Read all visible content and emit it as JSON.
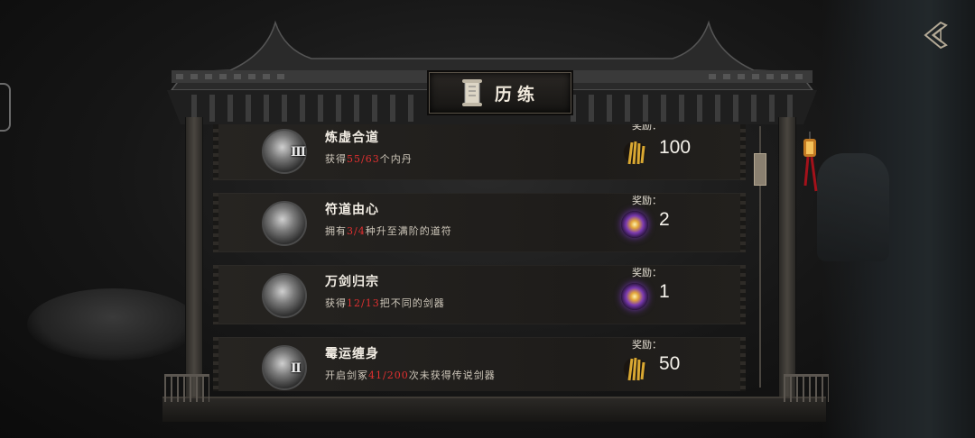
{
  "window": {
    "title": "历练"
  },
  "quests": [
    {
      "name": "炼虚合道",
      "desc_prefix": "获得",
      "progress": "55/63",
      "desc_suffix": "个内丹",
      "roman": "Ⅲ",
      "reward_label": "奖励：",
      "reward_icon": "gold-sword-bundle-icon",
      "reward_amount": "100"
    },
    {
      "name": "符道由心",
      "desc_prefix": "拥有",
      "progress": "3/4",
      "desc_suffix": "种升至满阶的道符",
      "roman": "",
      "reward_label": "奖励：",
      "reward_icon": "spirit-orb-icon",
      "reward_amount": "2"
    },
    {
      "name": "万剑归宗",
      "desc_prefix": "获得",
      "progress": "12/13",
      "desc_suffix": "把不同的剑器",
      "roman": "",
      "reward_label": "奖励：",
      "reward_icon": "spirit-orb-icon",
      "reward_amount": "1"
    },
    {
      "name": "霉运缠身",
      "desc_prefix": "开启剑冢",
      "progress": "41/200",
      "desc_suffix": "次未获得传说剑器",
      "roman": "Ⅱ",
      "reward_label": "奖励：",
      "reward_icon": "gold-sword-bundle-icon",
      "reward_amount": "50"
    }
  ],
  "colors": {
    "progress": "#e23030",
    "gold": "#d9a832",
    "orb": "#7a3ab0"
  }
}
